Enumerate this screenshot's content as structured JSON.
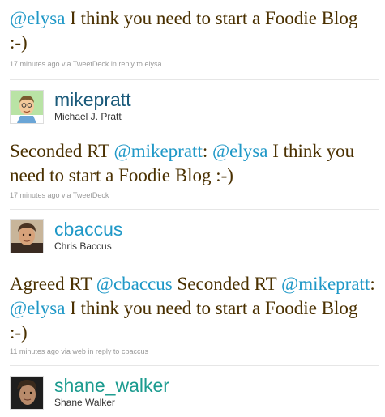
{
  "tweet1": {
    "mention": "@elysa",
    "text": " I think you need to start a Foodie Blog :-)",
    "time": "17 minutes ago",
    "via_prefix": " via ",
    "source": "TweetDeck",
    "reply_prefix": " in reply to ",
    "reply_to": "elysa"
  },
  "user1": {
    "screen_name": "mikepratt",
    "full_name": "Michael J. Pratt",
    "avatar_icon": "cartoon-avatar"
  },
  "tweet2": {
    "part1": "Seconded RT ",
    "mention1": "@mikepratt",
    "part2": ": ",
    "mention2": "@elysa",
    "part3": " I think you need to start a Foodie Blog :-)",
    "time": "17 minutes ago",
    "via_prefix": " via ",
    "source": "TweetDeck"
  },
  "user2": {
    "screen_name": "cbaccus",
    "full_name": "Chris Baccus",
    "avatar_icon": "photo-avatar"
  },
  "tweet3": {
    "part1": "Agreed RT ",
    "mention1": "@cbaccus",
    "part2": " Seconded RT ",
    "mention2": "@mikepratt",
    "part3": ": ",
    "mention3": "@elysa",
    "part4": " I think you need to start a Foodie Blog :-)",
    "time": "11 minutes ago",
    "via_prefix": " via ",
    "source": "web",
    "reply_prefix": " in reply to ",
    "reply_to": "cbaccus"
  },
  "user3": {
    "screen_name": "shane_walker",
    "full_name": "Shane Walker",
    "avatar_icon": "photo-avatar"
  },
  "colors": {
    "link": "#1f98c7",
    "text": "#4a3000",
    "meta": "#9a9a9a"
  }
}
